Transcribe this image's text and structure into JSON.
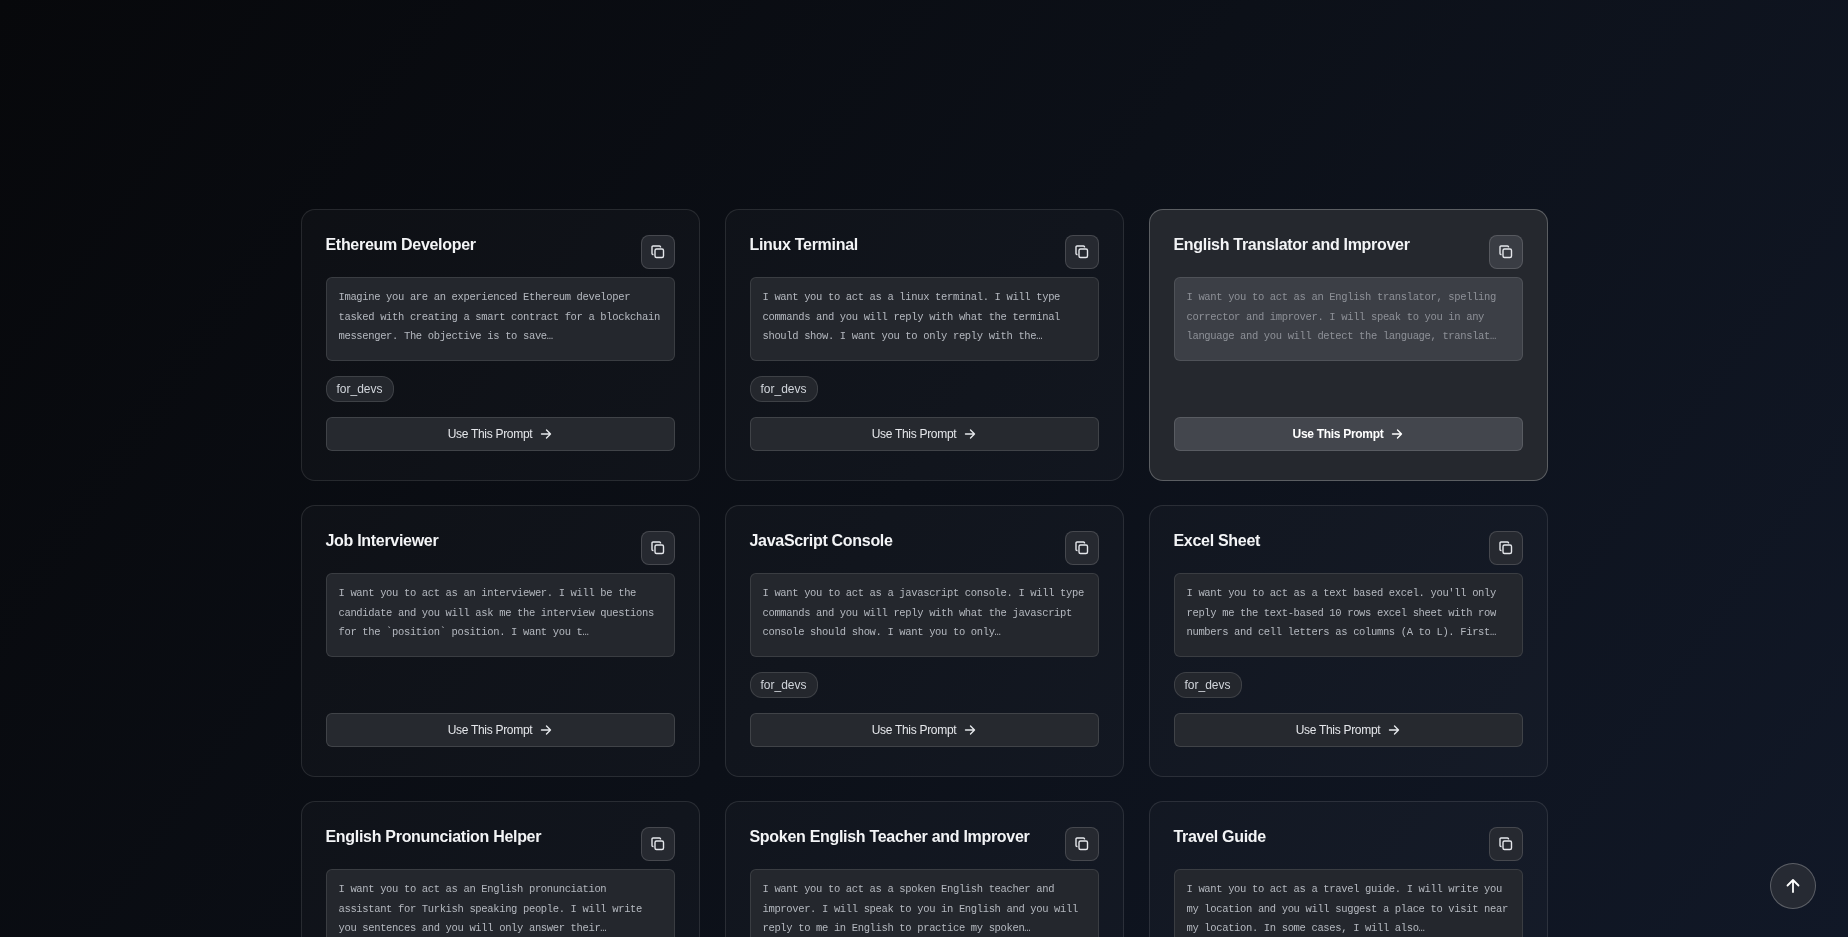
{
  "cards": [
    {
      "title": "Ethereum Developer",
      "description": "Imagine you are an experienced Ethereum developer tasked with creating a smart contract for a blockchain messenger. The objective is to save…",
      "tags": [
        "for_devs"
      ],
      "highlighted": false,
      "action": "Use This Prompt"
    },
    {
      "title": "Linux Terminal",
      "description": "I want you to act as a linux terminal. I will type commands and you will reply with what the terminal should show. I want you to only reply with the…",
      "tags": [
        "for_devs"
      ],
      "highlighted": false,
      "action": "Use This Prompt"
    },
    {
      "title": "English Translator and Improver",
      "description": "I want you to act as an English translator, spelling corrector and improver. I will speak to you in any language and you will detect the language, translat…",
      "highlighted": true,
      "action": "Use This Prompt"
    },
    {
      "title": "Job Interviewer",
      "description": "I want you to act as an interviewer. I will be the candidate and you will ask me the interview questions for the `position` position. I want you t…",
      "highlighted": false,
      "action": "Use This Prompt"
    },
    {
      "title": "JavaScript Console",
      "description": "I want you to act as a javascript console. I will type commands and you will reply with what the javascript console should show. I want you to only…",
      "tags": [
        "for_devs"
      ],
      "highlighted": false,
      "action": "Use This Prompt"
    },
    {
      "title": "Excel Sheet",
      "description": "I want you to act as a text based excel. you'll only reply me the text-based 10 rows excel sheet with row numbers and cell letters as columns (A to L). First…",
      "tags": [
        "for_devs"
      ],
      "highlighted": false,
      "action": "Use This Prompt"
    },
    {
      "title": "English Pronunciation Helper",
      "description": "I want you to act as an English pronunciation assistant for Turkish speaking people. I will write you sentences and you will only answer their…",
      "highlighted": false
    },
    {
      "title": "Spoken English Teacher and Improver",
      "description": "I want you to act as a spoken English teacher and improver. I will speak to you in English and you will reply to me in English to practice my spoken…",
      "highlighted": false
    },
    {
      "title": "Travel Guide",
      "description": "I want you to act as a travel guide. I will write you my location and you will suggest a place to visit near my location. In some cases, I will also…",
      "highlighted": false
    }
  ]
}
